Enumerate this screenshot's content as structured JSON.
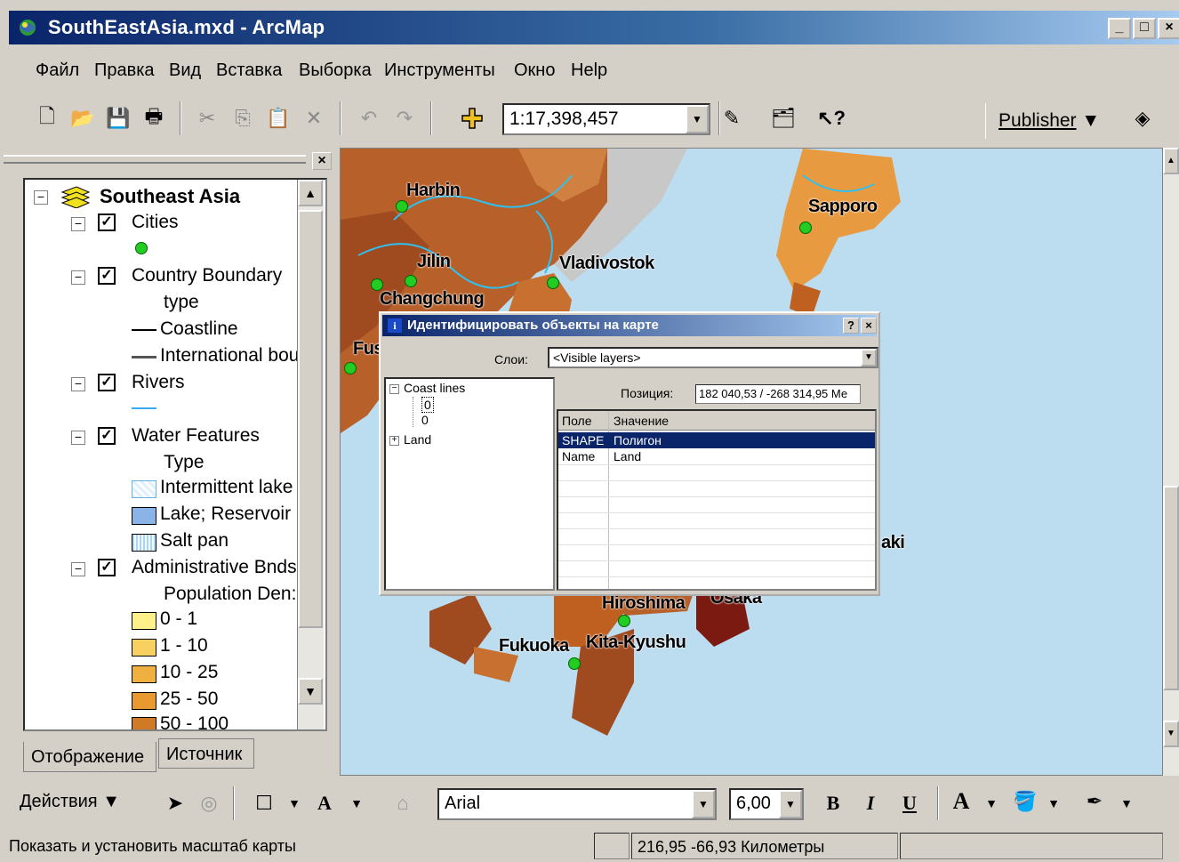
{
  "window": {
    "title": "SouthEastAsia.mxd - ArcMap"
  },
  "menu": [
    "Файл",
    "Правка",
    "Вид",
    "Вставка",
    "Выборка",
    "Инструменты",
    "Окно",
    "Help"
  ],
  "toolbar": {
    "scale": "1:17,398,457",
    "publisher": "Publisher"
  },
  "toc": {
    "root": "Southeast Asia",
    "layers": {
      "cities": "Cities",
      "country_boundary": "Country Boundary",
      "cb_type": "type",
      "coastline": "Coastline",
      "international": "International bou",
      "rivers": "Rivers",
      "water_features": "Water Features",
      "wf_type": "Type",
      "intermittent": "Intermittent lake",
      "lake": "Lake; Reservoir",
      "saltpan": "Salt pan",
      "admin": "Administrative Bnds",
      "pop_density": "Population Den:",
      "c1": "0 - 1",
      "c2": "1 - 10",
      "c3": "10 - 25",
      "c4": "25 - 50",
      "c5": "50 - 100"
    },
    "tabs": {
      "display": "Отображение",
      "source": "Источник"
    }
  },
  "map": {
    "cities": {
      "harbin": "Harbin",
      "sapporo": "Sapporo",
      "jilin": "Jilin",
      "vladivostok": "Vladivostok",
      "changchung": "Changchung",
      "fus": "Fus",
      "aki": "aki",
      "hiroshima": "Hiroshima",
      "osaka": "Osaka",
      "fukuoka": "Fukuoka",
      "kitakyushu": "Kita-Kyushu"
    },
    "colors": {
      "water": "#bcdcf0",
      "land_dark": "#8b3a1a",
      "land_mid": "#b8602a",
      "land_light": "#e89a40",
      "gray": "#c8c8c8"
    }
  },
  "identify": {
    "title": "Идентифицировать объекты на карте",
    "layers_label": "Слои:",
    "layers_value": "<Visible layers>",
    "tree": {
      "coastlines": "Coast lines",
      "v1": "0",
      "v2": "0",
      "land": "Land"
    },
    "position_label": "Позиция:",
    "position_value": "182 040,53 / -268 314,95 Ме",
    "columns": {
      "field": "Поле",
      "value": "Значение"
    },
    "rows": {
      "r1_field": "SHAPE",
      "r1_value": "Полигон",
      "r2_field": "Name",
      "r2_value": "Land"
    }
  },
  "drawing": {
    "actions": "Действия",
    "font": "Arial",
    "size": "6,00",
    "bold": "B",
    "italic": "I",
    "underline": "U",
    "font_color": "A",
    "text_tool": "A"
  },
  "status": {
    "message": "Показать и установить масштаб карты",
    "coords": "216,95  -66,93 Километры"
  }
}
